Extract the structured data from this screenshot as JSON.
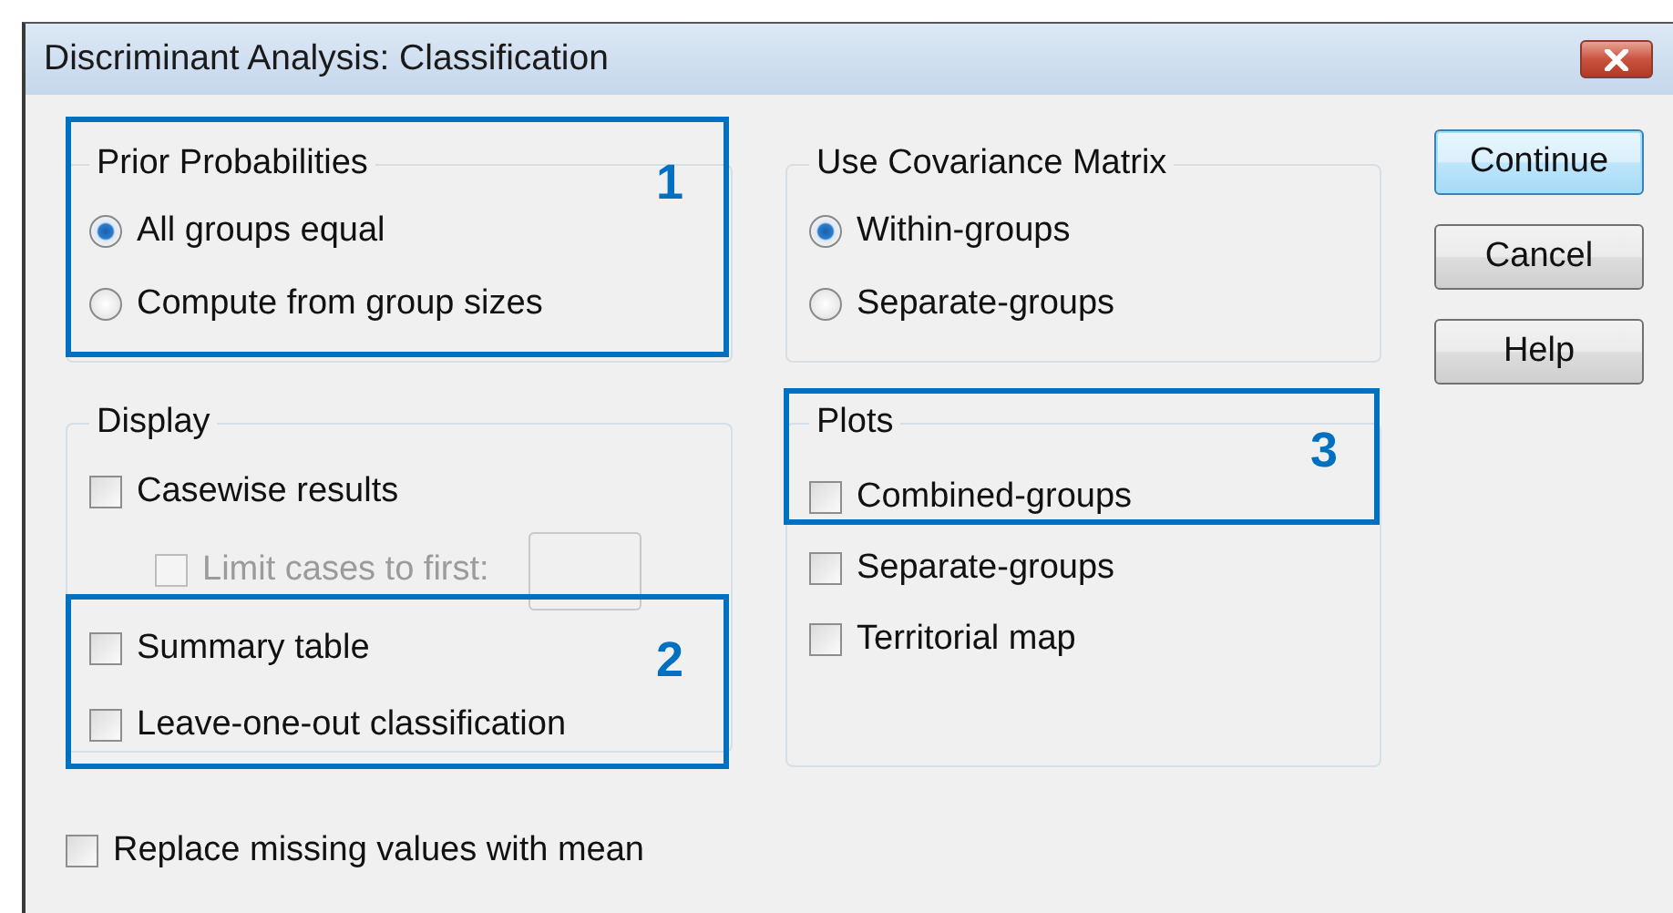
{
  "window": {
    "title": "Discriminant Analysis: Classification"
  },
  "prior_probabilities": {
    "title": "Prior Probabilities",
    "options": [
      {
        "label": "All groups equal",
        "selected": true
      },
      {
        "label": "Compute from group sizes",
        "selected": false
      }
    ]
  },
  "covariance_matrix": {
    "title": "Use Covariance Matrix",
    "options": [
      {
        "label": "Within-groups",
        "selected": true
      },
      {
        "label": "Separate-groups",
        "selected": false
      }
    ]
  },
  "display": {
    "title": "Display",
    "items": [
      {
        "kind": "checkbox",
        "label": "Casewise results",
        "checked": false,
        "disabled": false
      },
      {
        "kind": "limit",
        "label": "Limit cases to first:",
        "checked": false,
        "disabled": true
      },
      {
        "kind": "checkbox",
        "label": "Summary table",
        "checked": false,
        "disabled": false
      },
      {
        "kind": "checkbox",
        "label": "Leave-one-out classification",
        "checked": false,
        "disabled": false
      }
    ]
  },
  "plots": {
    "title": "Plots",
    "items": [
      {
        "label": "Combined-groups",
        "checked": false
      },
      {
        "label": "Separate-groups",
        "checked": false
      },
      {
        "label": "Territorial map",
        "checked": false
      }
    ]
  },
  "replace_missing": {
    "label": "Replace missing values with mean",
    "checked": false
  },
  "buttons": [
    {
      "label": "Continue",
      "default": true
    },
    {
      "label": "Cancel",
      "default": false
    },
    {
      "label": "Help",
      "default": false
    }
  ],
  "callouts": [
    {
      "number": "1"
    },
    {
      "number": "2"
    },
    {
      "number": "3"
    }
  ]
}
